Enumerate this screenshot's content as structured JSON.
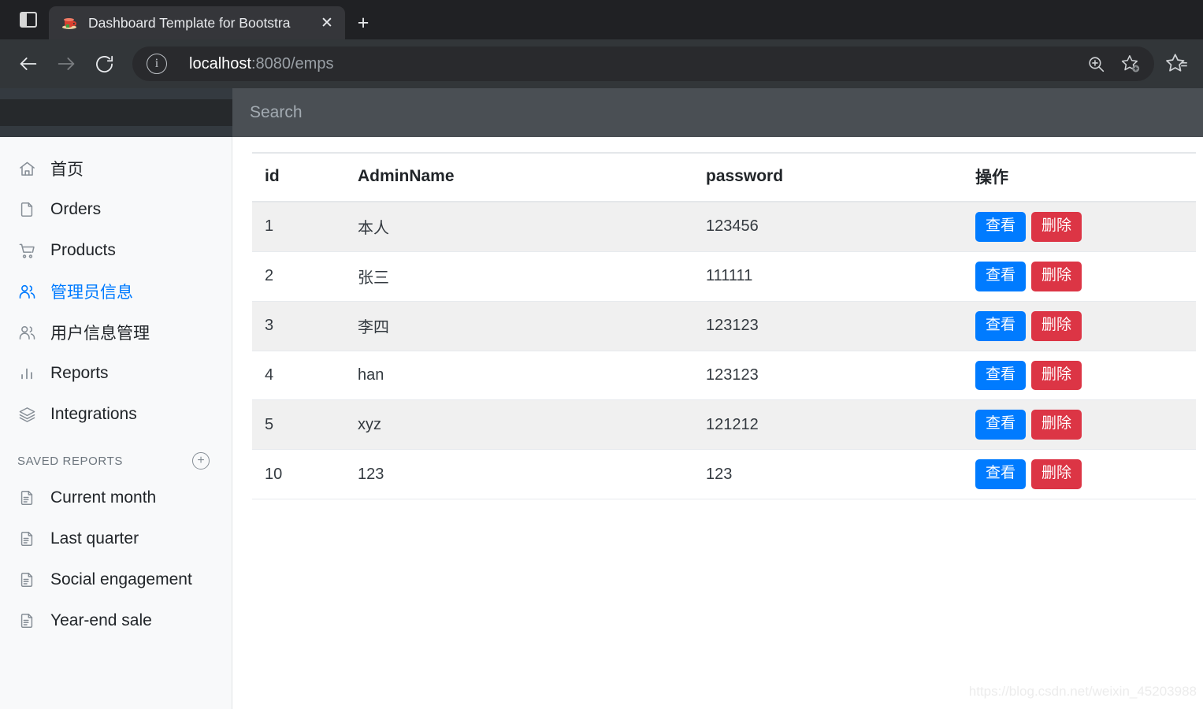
{
  "browser": {
    "tab": {
      "title": "Dashboard Template for Bootstra",
      "favicon": "coffee-cup-icon",
      "close_label": "✕"
    },
    "new_tab_label": "+",
    "toolbar": {
      "back_label": "←",
      "forward_label": "→",
      "reload_label": "↻",
      "site_info_label": "i",
      "url_host": "localhost",
      "url_rest": ":8080/emps",
      "zoom_icon": "zoom-in-icon",
      "favorite_icon": "add-favorite-star-icon",
      "collections_icon": "favorites-star-icon"
    }
  },
  "app": {
    "search": {
      "placeholder": "Search",
      "value": ""
    },
    "sidebar": {
      "items": [
        {
          "label": "首页",
          "icon": "home-icon",
          "active": false
        },
        {
          "label": "Orders",
          "icon": "file-icon",
          "active": false
        },
        {
          "label": "Products",
          "icon": "shopping-cart-icon",
          "active": false
        },
        {
          "label": "管理员信息",
          "icon": "people-icon",
          "active": true
        },
        {
          "label": "用户信息管理",
          "icon": "people-icon",
          "active": false
        },
        {
          "label": "Reports",
          "icon": "bar-chart-icon",
          "active": false
        },
        {
          "label": "Integrations",
          "icon": "layers-icon",
          "active": false
        }
      ],
      "saved_reports": {
        "title": "SAVED REPORTS",
        "add_label": "+",
        "items": [
          {
            "label": "Current month",
            "icon": "document-icon"
          },
          {
            "label": "Last quarter",
            "icon": "document-icon"
          },
          {
            "label": "Social engagement",
            "icon": "document-icon"
          },
          {
            "label": "Year-end sale",
            "icon": "document-icon"
          }
        ]
      }
    },
    "table": {
      "columns": [
        "id",
        "AdminName",
        "password",
        "操作"
      ],
      "action_labels": {
        "view": "查看",
        "delete": "删除"
      },
      "rows": [
        {
          "id": "1",
          "name": "本人",
          "password": "123456"
        },
        {
          "id": "2",
          "name": "张三",
          "password": "111111"
        },
        {
          "id": "3",
          "name": "李四",
          "password": "123123"
        },
        {
          "id": "4",
          "name": "han",
          "password": "123123"
        },
        {
          "id": "5",
          "name": "xyz",
          "password": "121212"
        },
        {
          "id": "10",
          "name": "123",
          "password": "123"
        }
      ]
    },
    "watermark": "https://blog.csdn.net/weixin_45203988"
  },
  "colors": {
    "primary": "#007bff",
    "danger": "#dc3545",
    "navbar_dark": "#343a40",
    "navbar_search": "#4a4f54",
    "sidebar_bg": "#f8f9fa"
  }
}
